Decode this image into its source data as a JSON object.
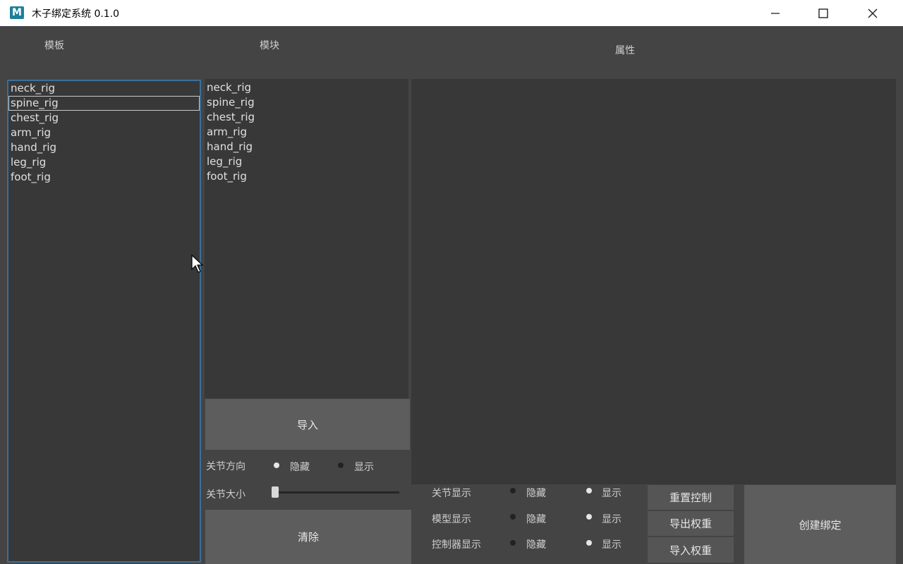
{
  "window": {
    "app_icon_text": "M",
    "title": "木子绑定系统 0.1.0",
    "controls": [
      "minimize-icon",
      "maximize-icon",
      "close-icon"
    ]
  },
  "sections": {
    "template_label": "模板",
    "module_label": "模块",
    "properties_label": "属性"
  },
  "template_list": {
    "items": [
      "neck_rig",
      "spine_rig",
      "chest_rig",
      "arm_rig",
      "hand_rig",
      "leg_rig",
      "foot_rig"
    ],
    "selected": "spine_rig"
  },
  "module_list": {
    "items": [
      "neck_rig",
      "spine_rig",
      "chest_rig",
      "arm_rig",
      "hand_rig",
      "leg_rig",
      "foot_rig"
    ]
  },
  "buttons": {
    "import": "导入",
    "clear": "清除",
    "reset_controls": "重置控制",
    "export_weights": "导出权重",
    "import_weights": "导入权重",
    "create_rig": "创建绑定"
  },
  "joint_orient": {
    "label": "关节方向",
    "hide": "隐藏",
    "show": "显示",
    "selected": "hide"
  },
  "joint_size": {
    "label": "关节大小",
    "value": 0
  },
  "display_options": [
    {
      "label": "关节显示",
      "hide": "隐藏",
      "show": "显示",
      "selected": "show"
    },
    {
      "label": "模型显示",
      "hide": "隐藏",
      "show": "显示",
      "selected": "show"
    },
    {
      "label": "控制器显示",
      "hide": "隐藏",
      "show": "显示",
      "selected": "show"
    }
  ],
  "colors": {
    "background": "#444444",
    "panel": "#383838",
    "button": "#5d5d5d"
  }
}
